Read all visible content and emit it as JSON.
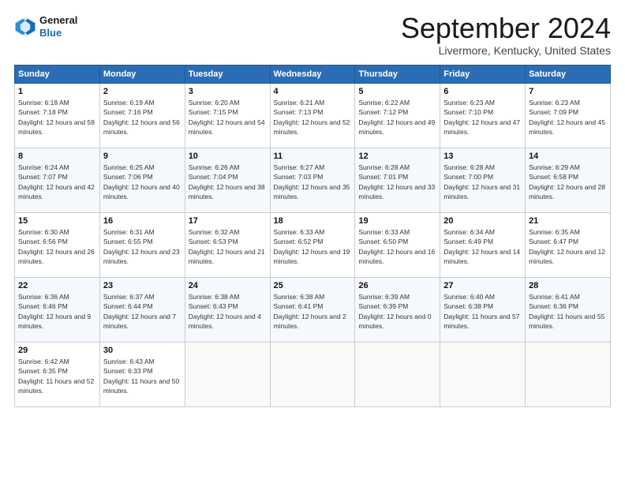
{
  "header": {
    "logo_line1": "General",
    "logo_line2": "Blue",
    "title": "September 2024",
    "location": "Livermore, Kentucky, United States"
  },
  "days_of_week": [
    "Sunday",
    "Monday",
    "Tuesday",
    "Wednesday",
    "Thursday",
    "Friday",
    "Saturday"
  ],
  "weeks": [
    [
      {
        "day": "1",
        "sunrise": "Sunrise: 6:18 AM",
        "sunset": "Sunset: 7:18 PM",
        "daylight": "Daylight: 12 hours and 59 minutes."
      },
      {
        "day": "2",
        "sunrise": "Sunrise: 6:19 AM",
        "sunset": "Sunset: 7:16 PM",
        "daylight": "Daylight: 12 hours and 56 minutes."
      },
      {
        "day": "3",
        "sunrise": "Sunrise: 6:20 AM",
        "sunset": "Sunset: 7:15 PM",
        "daylight": "Daylight: 12 hours and 54 minutes."
      },
      {
        "day": "4",
        "sunrise": "Sunrise: 6:21 AM",
        "sunset": "Sunset: 7:13 PM",
        "daylight": "Daylight: 12 hours and 52 minutes."
      },
      {
        "day": "5",
        "sunrise": "Sunrise: 6:22 AM",
        "sunset": "Sunset: 7:12 PM",
        "daylight": "Daylight: 12 hours and 49 minutes."
      },
      {
        "day": "6",
        "sunrise": "Sunrise: 6:23 AM",
        "sunset": "Sunset: 7:10 PM",
        "daylight": "Daylight: 12 hours and 47 minutes."
      },
      {
        "day": "7",
        "sunrise": "Sunrise: 6:23 AM",
        "sunset": "Sunset: 7:09 PM",
        "daylight": "Daylight: 12 hours and 45 minutes."
      }
    ],
    [
      {
        "day": "8",
        "sunrise": "Sunrise: 6:24 AM",
        "sunset": "Sunset: 7:07 PM",
        "daylight": "Daylight: 12 hours and 42 minutes."
      },
      {
        "day": "9",
        "sunrise": "Sunrise: 6:25 AM",
        "sunset": "Sunset: 7:06 PM",
        "daylight": "Daylight: 12 hours and 40 minutes."
      },
      {
        "day": "10",
        "sunrise": "Sunrise: 6:26 AM",
        "sunset": "Sunset: 7:04 PM",
        "daylight": "Daylight: 12 hours and 38 minutes."
      },
      {
        "day": "11",
        "sunrise": "Sunrise: 6:27 AM",
        "sunset": "Sunset: 7:03 PM",
        "daylight": "Daylight: 12 hours and 35 minutes."
      },
      {
        "day": "12",
        "sunrise": "Sunrise: 6:28 AM",
        "sunset": "Sunset: 7:01 PM",
        "daylight": "Daylight: 12 hours and 33 minutes."
      },
      {
        "day": "13",
        "sunrise": "Sunrise: 6:28 AM",
        "sunset": "Sunset: 7:00 PM",
        "daylight": "Daylight: 12 hours and 31 minutes."
      },
      {
        "day": "14",
        "sunrise": "Sunrise: 6:29 AM",
        "sunset": "Sunset: 6:58 PM",
        "daylight": "Daylight: 12 hours and 28 minutes."
      }
    ],
    [
      {
        "day": "15",
        "sunrise": "Sunrise: 6:30 AM",
        "sunset": "Sunset: 6:56 PM",
        "daylight": "Daylight: 12 hours and 26 minutes."
      },
      {
        "day": "16",
        "sunrise": "Sunrise: 6:31 AM",
        "sunset": "Sunset: 6:55 PM",
        "daylight": "Daylight: 12 hours and 23 minutes."
      },
      {
        "day": "17",
        "sunrise": "Sunrise: 6:32 AM",
        "sunset": "Sunset: 6:53 PM",
        "daylight": "Daylight: 12 hours and 21 minutes."
      },
      {
        "day": "18",
        "sunrise": "Sunrise: 6:33 AM",
        "sunset": "Sunset: 6:52 PM",
        "daylight": "Daylight: 12 hours and 19 minutes."
      },
      {
        "day": "19",
        "sunrise": "Sunrise: 6:33 AM",
        "sunset": "Sunset: 6:50 PM",
        "daylight": "Daylight: 12 hours and 16 minutes."
      },
      {
        "day": "20",
        "sunrise": "Sunrise: 6:34 AM",
        "sunset": "Sunset: 6:49 PM",
        "daylight": "Daylight: 12 hours and 14 minutes."
      },
      {
        "day": "21",
        "sunrise": "Sunrise: 6:35 AM",
        "sunset": "Sunset: 6:47 PM",
        "daylight": "Daylight: 12 hours and 12 minutes."
      }
    ],
    [
      {
        "day": "22",
        "sunrise": "Sunrise: 6:36 AM",
        "sunset": "Sunset: 6:46 PM",
        "daylight": "Daylight: 12 hours and 9 minutes."
      },
      {
        "day": "23",
        "sunrise": "Sunrise: 6:37 AM",
        "sunset": "Sunset: 6:44 PM",
        "daylight": "Daylight: 12 hours and 7 minutes."
      },
      {
        "day": "24",
        "sunrise": "Sunrise: 6:38 AM",
        "sunset": "Sunset: 6:43 PM",
        "daylight": "Daylight: 12 hours and 4 minutes."
      },
      {
        "day": "25",
        "sunrise": "Sunrise: 6:38 AM",
        "sunset": "Sunset: 6:41 PM",
        "daylight": "Daylight: 12 hours and 2 minutes."
      },
      {
        "day": "26",
        "sunrise": "Sunrise: 6:39 AM",
        "sunset": "Sunset: 6:39 PM",
        "daylight": "Daylight: 12 hours and 0 minutes."
      },
      {
        "day": "27",
        "sunrise": "Sunrise: 6:40 AM",
        "sunset": "Sunset: 6:38 PM",
        "daylight": "Daylight: 11 hours and 57 minutes."
      },
      {
        "day": "28",
        "sunrise": "Sunrise: 6:41 AM",
        "sunset": "Sunset: 6:36 PM",
        "daylight": "Daylight: 11 hours and 55 minutes."
      }
    ],
    [
      {
        "day": "29",
        "sunrise": "Sunrise: 6:42 AM",
        "sunset": "Sunset: 6:35 PM",
        "daylight": "Daylight: 11 hours and 52 minutes."
      },
      {
        "day": "30",
        "sunrise": "Sunrise: 6:43 AM",
        "sunset": "Sunset: 6:33 PM",
        "daylight": "Daylight: 11 hours and 50 minutes."
      },
      null,
      null,
      null,
      null,
      null
    ]
  ]
}
